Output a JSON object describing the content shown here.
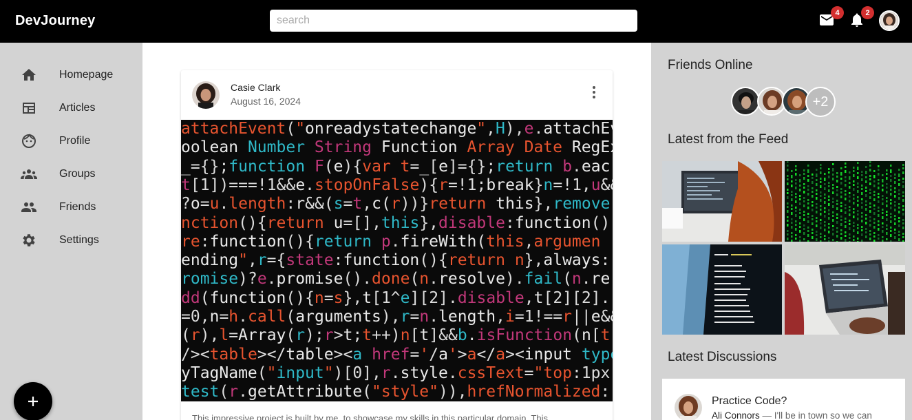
{
  "header": {
    "brand": "DevJourney",
    "search_placeholder": "search",
    "mail_count": "4",
    "notification_count": "2",
    "icons": [
      "mail-icon",
      "bell-icon",
      "user-avatar"
    ]
  },
  "sidebar": {
    "items": [
      {
        "label": "Homepage",
        "icon": "home-icon"
      },
      {
        "label": "Articles",
        "icon": "articles-icon"
      },
      {
        "label": "Profile",
        "icon": "face-icon"
      },
      {
        "label": "Groups",
        "icon": "groups-icon"
      },
      {
        "label": "Friends",
        "icon": "people-icon"
      },
      {
        "label": "Settings",
        "icon": "gear-icon"
      }
    ],
    "fab_icon": "plus-icon"
  },
  "post": {
    "author": "Casie Clark",
    "date": "August 16, 2024",
    "body": "This impressive project is built by me, to showcase my skills in this particular domain. This",
    "code_lines": [
      "attachEvent(\"onreadystatechange\",H),e.attachEv",
      "oolean Number String Function Array Date RegEx",
      "_={};function F(e){var t=_[e]={};return b.eac",
      "t[1])===!1&&e.stopOnFalse){r=!1;break}n=!1,u&&",
      "?o=u.length:r&&(s=t,c(r))}return this},remove",
      "nction(){return u=[],this},disable:function()",
      "re:function(){return p.fireWith(this,argumen",
      "ending\",r={state:function(){return n},always:",
      "romise)?e.promise().done(n.resolve).fail(n.re",
      "dd(function(){n=s},t[1^e][2].disable,t[2][2].",
      "=0,n=h.call(arguments),r=n.length,i=1!==r||e&&",
      "(r),l=Array(r);r>t;t++)n[t]&&b.isFunction(n[t",
      "/><table></table><a href='/a'>a</a><input type",
      "yTagName(\"input\")[0],r.style.cssText=\"top:1px",
      "test(r.getAttribute(\"style\")),hrefNormalized:"
    ]
  },
  "right_panel": {
    "friends_title": "Friends Online",
    "friends_more": "+2",
    "feed_title": "Latest from the Feed",
    "discussions_title": "Latest Discussions",
    "discussion": {
      "title": "Practice Code?",
      "author": "Ali Connors",
      "snippet": " — I'll be in town so we can"
    }
  },
  "colors": {
    "header_bg": "#000000",
    "sidebar_bg": "#d3d3d3",
    "badge": "#d32f2f",
    "code_red": "#e8542f",
    "code_cyan": "#2fb9c8",
    "code_magenta": "#c2387a"
  }
}
